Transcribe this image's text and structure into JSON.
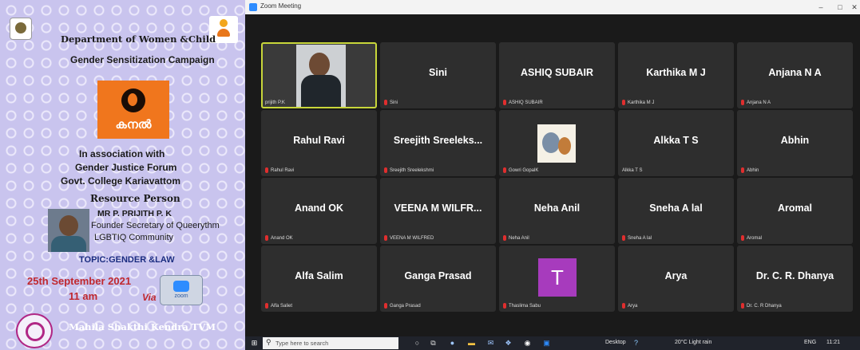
{
  "poster": {
    "department": "Department of Women &Child",
    "campaign": "Gender  Sensitization Campaign",
    "kanal_label": "കനൽ",
    "association_1": "In association with",
    "association_2": "Gender Justice Forum",
    "association_3": "Govt. College Kariavattom",
    "resource_heading": "Resource Person",
    "resource_name": "MR P. PRIJITH P. K",
    "resource_role_1": "Founder Secretary of Queerythm",
    "resource_role_2": "LGBTIQ Community",
    "topic": "TOPIC:GENDER &LAW",
    "date": "25th September 2021",
    "time": "11 am",
    "via": "Via",
    "zoom_label": "zoom",
    "footer": "Mahila  Shakthi Kendra TVM"
  },
  "window": {
    "title": "Zoom Meeting",
    "controls": [
      "–",
      "□",
      "✕"
    ]
  },
  "participants": [
    {
      "name": "",
      "label": "prijith P.K",
      "kind": "video",
      "active": true,
      "muted": false
    },
    {
      "name": "Sini",
      "label": "Sini",
      "kind": "name",
      "muted": true
    },
    {
      "name": "ASHIQ SUBAIR",
      "label": "ASHIQ SUBAIR",
      "kind": "name",
      "muted": true
    },
    {
      "name": "Karthika M J",
      "label": "Karthika M J",
      "kind": "name",
      "muted": true
    },
    {
      "name": "Anjana N A",
      "label": "Anjana N A",
      "kind": "name",
      "muted": true
    },
    {
      "name": "Rahul Ravi",
      "label": "Rahul Ravi",
      "kind": "name",
      "muted": true
    },
    {
      "name": "Sreejith  Sreeleks...",
      "label": "Sreejith Sreelekshmi",
      "kind": "name",
      "muted": true
    },
    {
      "name": "",
      "label": "Gowri GopalK",
      "kind": "image",
      "muted": true
    },
    {
      "name": "Alkka T S",
      "label": "Alkka T S",
      "kind": "name",
      "muted": false
    },
    {
      "name": "Abhin",
      "label": "Abhin",
      "kind": "name",
      "muted": true
    },
    {
      "name": "Anand OK",
      "label": "Anand OK",
      "kind": "name",
      "muted": true
    },
    {
      "name": "VEENA M WILFR...",
      "label": "VEENA M WILFRED",
      "kind": "name",
      "muted": true
    },
    {
      "name": "Neha Anil",
      "label": "Neha Anil",
      "kind": "name",
      "muted": true
    },
    {
      "name": "Sneha A lal",
      "label": "Sneha A lal",
      "kind": "name",
      "muted": true
    },
    {
      "name": "Aromal",
      "label": "Aromal",
      "kind": "name",
      "muted": true
    },
    {
      "name": "Alfa Salim",
      "label": "Alfa Saliet",
      "kind": "name",
      "muted": true
    },
    {
      "name": "Ganga Prasad",
      "label": "Ganga Prasad",
      "kind": "name",
      "muted": true
    },
    {
      "name": "",
      "label": "Thaslima Sabu",
      "kind": "letter",
      "letter": "T",
      "muted": true
    },
    {
      "name": "Arya",
      "label": "Arya",
      "kind": "name",
      "muted": true
    },
    {
      "name": "Dr. C. R. Dhanya",
      "label": "Dr. C. R Dhanya",
      "kind": "name",
      "muted": true
    }
  ],
  "taskbar": {
    "search_placeholder": "Type here to search",
    "desktop": "Desktop",
    "weather": "20°C  Light rain",
    "lang": "ENG",
    "time": "11:21"
  },
  "colors": {
    "active_border": "#c8d63a",
    "mic_off": "#e02e2e",
    "avatar_purple": "#a73bbd"
  }
}
